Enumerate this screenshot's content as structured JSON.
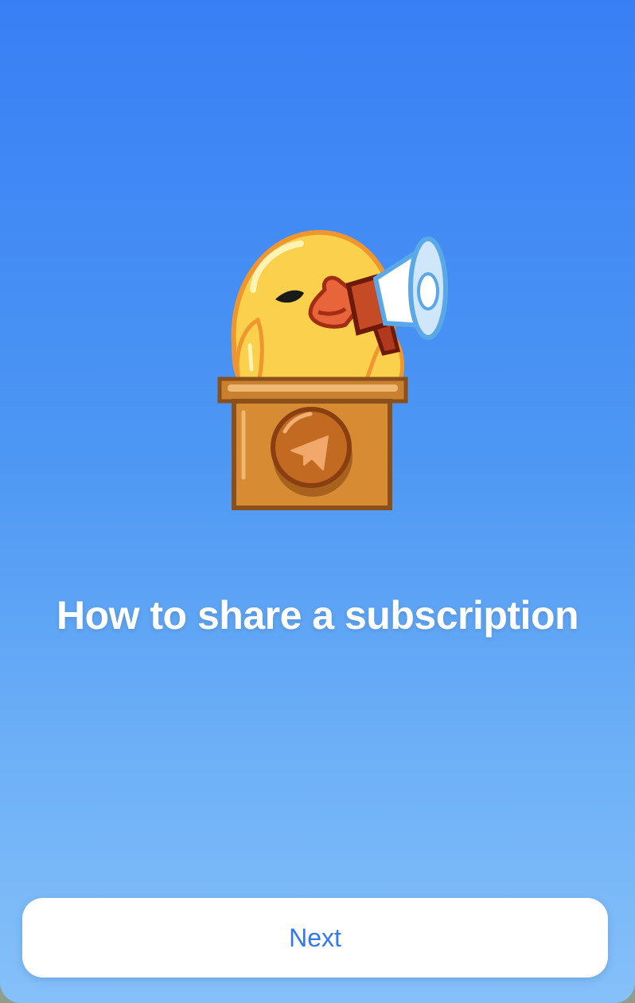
{
  "onboarding": {
    "sticker_icon": "duck-megaphone-podium-icon",
    "title": "How to share a subscription",
    "next_label": "Next"
  },
  "colors": {
    "background_top": "#387ff5",
    "background_bottom": "#85c0f9",
    "title_text": "#ffffff",
    "button_bg": "#ffffff",
    "button_text": "#3478f0"
  }
}
